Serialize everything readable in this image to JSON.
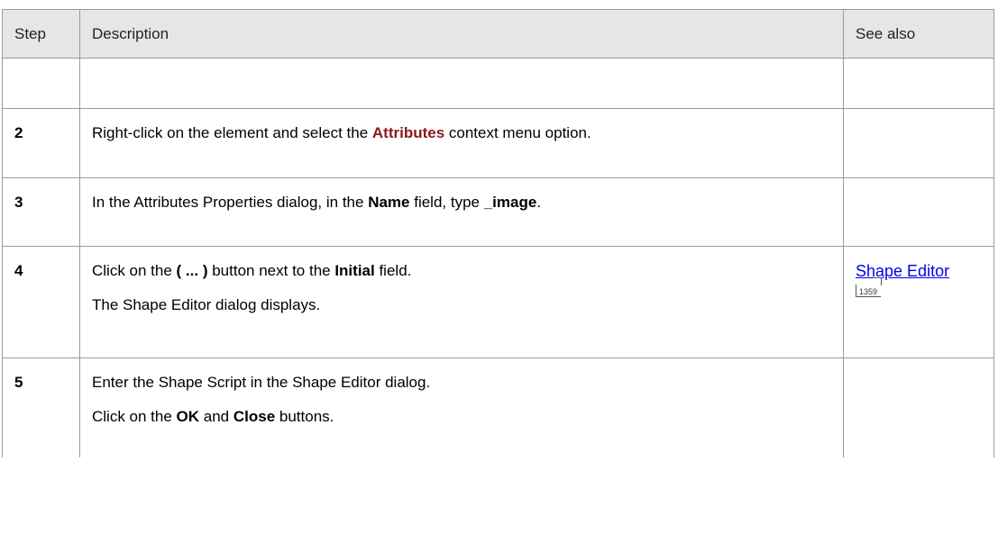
{
  "table": {
    "headers": {
      "step": "Step",
      "description": "Description",
      "see_also": "See also"
    },
    "rows": [
      {
        "step": "2",
        "desc": {
          "pre": "Right-click on the element and select the ",
          "kw": "Attributes",
          "post": " context menu option."
        }
      },
      {
        "step": "3",
        "desc": {
          "pre": "In the Attributes Properties dialog, in the ",
          "b1": "Name",
          "mid": " field, type ",
          "b2": "_image",
          "post": "."
        }
      },
      {
        "step": "4",
        "desc": {
          "pre": "Click on the ",
          "b1": "( ... )",
          "mid": " button next to the ",
          "b2": "Initial",
          "post": " field.",
          "line2": "The Shape Editor dialog displays."
        },
        "see_also": {
          "link": "Shape Editor",
          "page": "1359"
        }
      },
      {
        "step": "5",
        "desc": {
          "line1": "Enter the Shape Script in the Shape Editor dialog.",
          "pre": "Click on the ",
          "b1": "OK",
          "mid": " and ",
          "b2": "Close",
          "post": " buttons."
        }
      }
    ]
  },
  "colors": {
    "header_bg": "#e6e6e6",
    "border": "#9a9a9a",
    "keyword": "#8b1a1a",
    "link": "#0000ee"
  }
}
